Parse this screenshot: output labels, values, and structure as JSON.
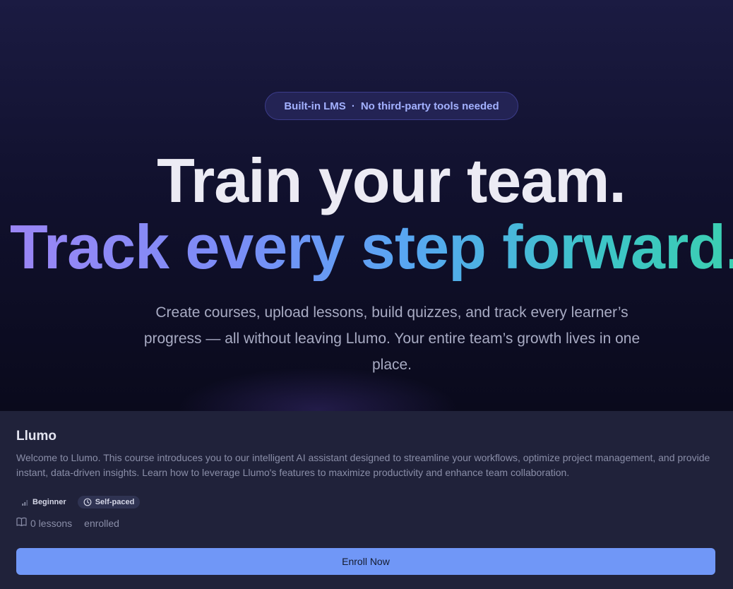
{
  "hero": {
    "badge": {
      "left_text": "Built-in LMS",
      "separator": "·",
      "right_text": "No third-party tools needed"
    },
    "headline_line1": "Train your team.",
    "headline_line2": "Track every step forward.",
    "subtitle": "Create courses, upload lessons, build quizzes, and track every learner’s progress — all without leaving Llumo. Your entire team’s growth lives in one place."
  },
  "course": {
    "title": "Llumo",
    "description": "Welcome to Llumo. This course introduces you to our intelligent AI assistant designed to streamline your workflows, optimize project management, and provide instant, data-driven insights. Learn how to leverage Llumo's features to maximize productivity and enhance team collaboration.",
    "tags": [
      {
        "label": "Beginner",
        "icon": "signal-bars-icon"
      },
      {
        "label": "Self-paced",
        "icon": "clock-icon"
      }
    ],
    "lessons_count": "0 lessons",
    "enrolled_label": "enrolled",
    "enroll_button": "Enroll Now"
  },
  "colors": {
    "accent": "#7097f7",
    "card_bg": "#20223a",
    "badge_text": "#a3b1ff"
  }
}
